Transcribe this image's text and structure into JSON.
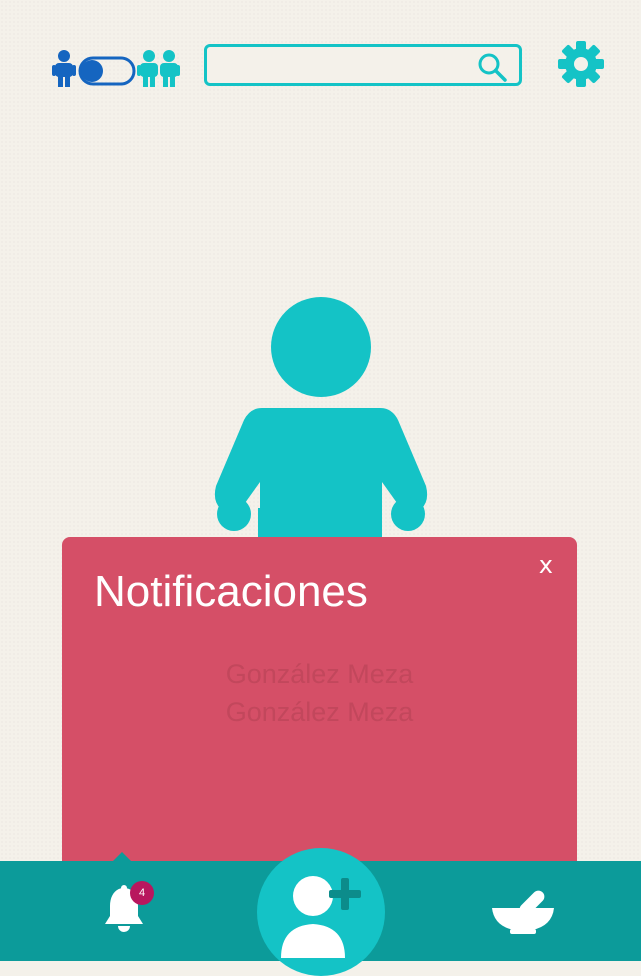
{
  "header": {
    "mode_toggle": {
      "state": "single",
      "icons": [
        "child-icon",
        "toggle-switch",
        "children-icon"
      ]
    },
    "search": {
      "value": "",
      "placeholder": "",
      "icon": "search-icon"
    },
    "settings_icon": "gear-icon"
  },
  "profile": {
    "avatar_icon": "person-icon",
    "name_lines": [
      "González Meza",
      "González Meza"
    ]
  },
  "notifications": {
    "title": "Notificaciones",
    "close_label": "x"
  },
  "bottom_nav": {
    "notifications_badge": "4",
    "items": [
      "bell-icon",
      "add-user-icon",
      "mortar-pestle-icon"
    ]
  },
  "colors": {
    "background": "#f4f1ea",
    "teal": "#14c3c6",
    "dark_teal": "#0c9b9a",
    "blue": "#1565c0",
    "panel": "#d54f67",
    "badge": "#b8175e"
  }
}
